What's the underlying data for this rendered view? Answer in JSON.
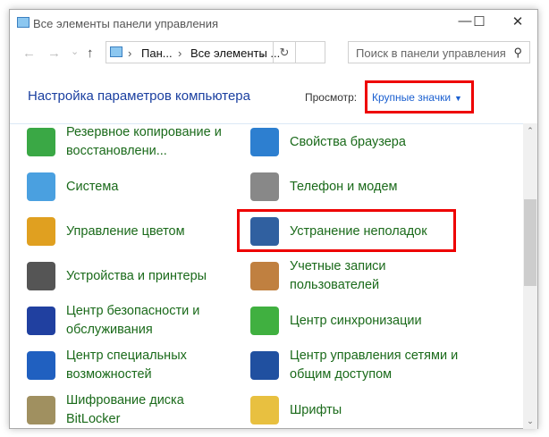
{
  "window": {
    "title": "Все элементы панели управления",
    "minimize": "—",
    "maximize": "☐",
    "close": "✕"
  },
  "nav": {
    "back": "←",
    "forward": "→",
    "recent": "⌄",
    "up": "↑"
  },
  "address": {
    "crumbs": [
      "Пан...",
      "Все элементы ..."
    ],
    "sep": "›",
    "dropdown": "⌄",
    "refresh": "↻"
  },
  "search": {
    "placeholder": "Поиск в панели управления",
    "icon": "⚲"
  },
  "header": {
    "title": "Настройка параметров компьютера",
    "view_label": "Просмотр:",
    "view_value": "Крупные значки",
    "view_arrow": "▼"
  },
  "items": [
    {
      "label": "Резервное копирование и восстановлени...",
      "icon": "backup-icon",
      "color": "#3aa845"
    },
    {
      "label": "Свойства браузера",
      "icon": "globe-icon",
      "color": "#2d7fd0"
    },
    {
      "label": "Система",
      "icon": "computer-icon",
      "color": "#4aa0e0"
    },
    {
      "label": "Телефон и модем",
      "icon": "phone-icon",
      "color": "#888888"
    },
    {
      "label": "Управление цветом",
      "icon": "color-icon",
      "color": "#e0a020"
    },
    {
      "label": "Устранение неполадок",
      "icon": "troubleshoot-icon",
      "color": "#3060a0"
    },
    {
      "label": "Устройства и принтеры",
      "icon": "printer-icon",
      "color": "#555555"
    },
    {
      "label": "Учетные записи пользователей",
      "icon": "users-icon",
      "color": "#c08040"
    },
    {
      "label": "Центр безопасности и обслуживания",
      "icon": "flag-icon",
      "color": "#2040a0"
    },
    {
      "label": "Центр синхронизации",
      "icon": "sync-icon",
      "color": "#40b040"
    },
    {
      "label": "Центр специальных возможностей",
      "icon": "accessibility-icon",
      "color": "#2060c0"
    },
    {
      "label": "Центр управления сетями и общим доступом",
      "icon": "network-icon",
      "color": "#2050a0"
    },
    {
      "label": "Шифрование диска BitLocker",
      "icon": "bitlocker-icon",
      "color": "#a09060"
    },
    {
      "label": "Шрифты",
      "icon": "fonts-icon",
      "color": "#e8c040"
    }
  ],
  "scrollbar": {
    "up": "⌃",
    "down": "⌄",
    "position": 0.8
  }
}
